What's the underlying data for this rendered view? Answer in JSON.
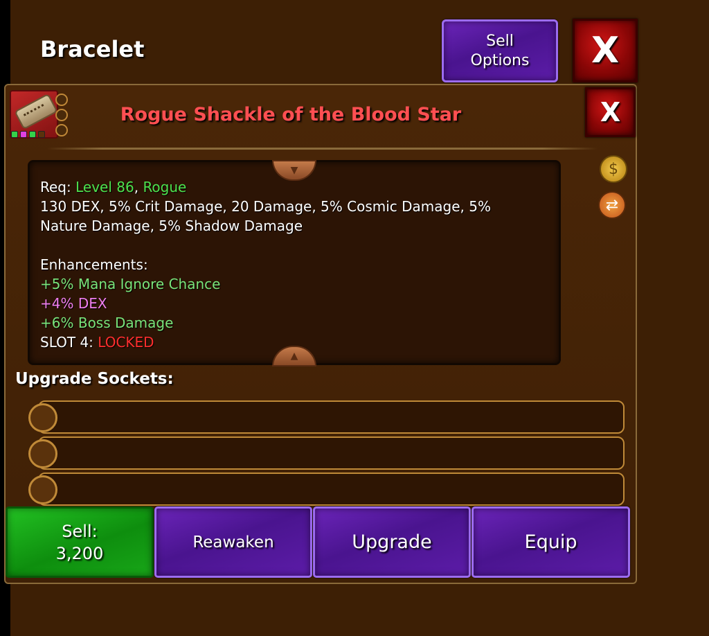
{
  "header": {
    "title": "Bracelet",
    "sell_options_line1": "Sell",
    "sell_options_line2": "Options",
    "close_label": "X"
  },
  "item": {
    "name": "Rogue Shackle of the Blood Star",
    "name_color": "#ff4f52",
    "close_label": "X",
    "gem_colors": [
      "#35d04a",
      "#e040e0",
      "#35d04a",
      "#5a320c"
    ]
  },
  "stats": {
    "req_label": "Req:",
    "req_level": "Level 86",
    "req_sep": ",",
    "req_class": "Rogue",
    "line1": "130 DEX, 5% Crit Damage, 20 Damage, 5% Cosmic Damage, 5%",
    "line2": "Nature Damage, 5% Shadow Damage",
    "enhancements_label": "Enhancements:",
    "enh1": "+5% Mana Ignore Chance",
    "enh2": "+4% DEX",
    "enh3": "+6% Boss Damage",
    "slot4_label": "SLOT 4:",
    "slot4_status": "LOCKED"
  },
  "side_icons": [
    "money-bag-icon",
    "swap-icon"
  ],
  "sockets": {
    "label": "Upgrade Sockets:",
    "count": 3
  },
  "actions": {
    "sell_label": "Sell:",
    "sell_price": "3,200",
    "reawaken_label": "Reawaken",
    "upgrade_label": "Upgrade",
    "equip_label": "Equip"
  }
}
